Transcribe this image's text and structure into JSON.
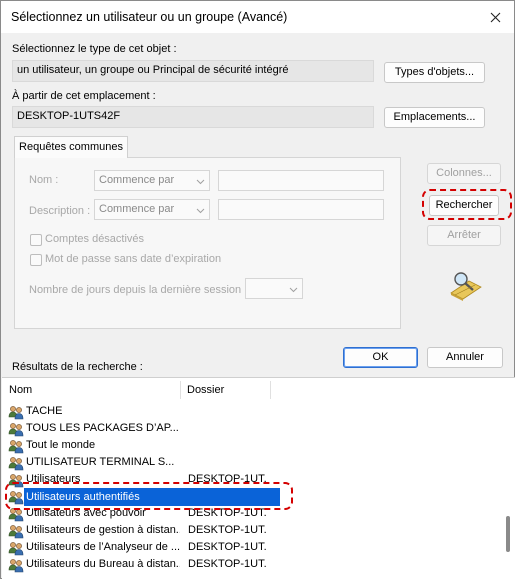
{
  "window": {
    "title": "Sélectionnez un utilisateur ou un groupe (Avancé)"
  },
  "object_type": {
    "label": "Sélectionnez le type de cet objet :",
    "value": "un utilisateur, un groupe ou Principal de sécurité intégré",
    "button": "Types d'objets..."
  },
  "location": {
    "label": "À partir de cet emplacement :",
    "value": "DESKTOP-1UTS42F",
    "button": "Emplacements..."
  },
  "tab": {
    "label": "Requêtes communes"
  },
  "query": {
    "name_label": "Nom :",
    "name_mode": "Commence par",
    "desc_label": "Description :",
    "desc_mode": "Commence par",
    "disabled_accounts": "Comptes désactivés",
    "no_expiry": "Mot de passe sans date d’expiration",
    "days_label": "Nombre de jours depuis la dernière session :"
  },
  "side_buttons": {
    "columns": "Colonnes...",
    "search": "Rechercher",
    "stop": "Arrêter"
  },
  "dialog_buttons": {
    "ok": "OK",
    "cancel": "Annuler"
  },
  "results": {
    "label": "Résultats de la recherche :",
    "columns": [
      "Nom",
      "Dossier"
    ],
    "rows": [
      {
        "name": "TACHE",
        "folder": ""
      },
      {
        "name": "TOUS LES PACKAGES D’AP...",
        "folder": ""
      },
      {
        "name": "Tout le monde",
        "folder": ""
      },
      {
        "name": "UTILISATEUR TERMINAL S...",
        "folder": ""
      },
      {
        "name": "Utilisateurs",
        "folder": "DESKTOP-1UT..."
      },
      {
        "name": "Utilisateurs authentifiés",
        "folder": ""
      },
      {
        "name": "Utilisateurs avec pouvoir",
        "folder": "DESKTOP-1UT..."
      },
      {
        "name": "Utilisateurs de gestion à distan...",
        "folder": "DESKTOP-1UT..."
      },
      {
        "name": "Utilisateurs de l’Analyseur de ...",
        "folder": "DESKTOP-1UT..."
      },
      {
        "name": "Utilisateurs du Bureau à distan...",
        "folder": "DESKTOP-1UT..."
      }
    ],
    "selected_index": 5
  },
  "colors": {
    "selection": "#0a63d8",
    "highlight": "#d40000",
    "accent": "#2f6fd0"
  },
  "icons": {
    "close": "close-icon",
    "user_group": "user-group-icon",
    "finder": "search-finder-icon",
    "chevron": "chevron-down-icon"
  }
}
